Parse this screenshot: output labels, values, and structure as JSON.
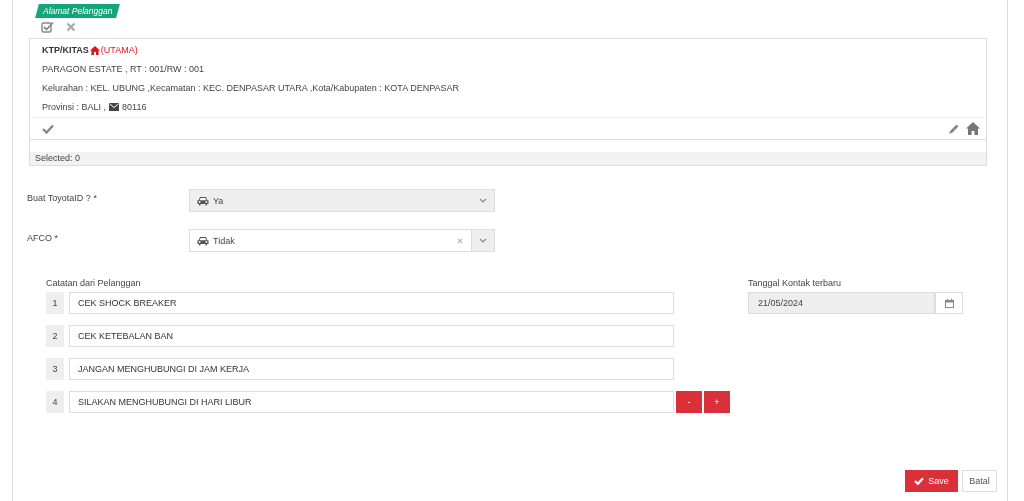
{
  "address_section": {
    "tag": "Alamat Pelanggan",
    "card": {
      "type": "KTP/KITAS",
      "primary_label": "(UTAMA)",
      "line_1": "PARAGON ESTATE , RT : 001/RW : 001",
      "line_2": "Kelurahan : KEL. UBUNG ,Kecamatan : KEC. DENPASAR UTARA ,Kota/Kabupaten : KOTA DENPASAR",
      "province": "Provinsi : BALI ,",
      "postal_code": "80116"
    },
    "selected_count": "Selected: 0"
  },
  "selects": [
    {
      "label": "Buat ToyotaID ? *",
      "value": "Ya",
      "disabled": true
    },
    {
      "label": "AFCO *",
      "value": "Tidak",
      "disabled": false
    }
  ],
  "notes": {
    "label": "Catatan dari Pelanggan",
    "items": [
      {
        "number": "1",
        "text": "CEK SHOCK BREAKER"
      },
      {
        "number": "2",
        "text": "CEK KETEBALAN BAN"
      },
      {
        "number": "3",
        "text": "JANGAN MENGHUBUNGI DI JAM KERJA"
      },
      {
        "number": "4",
        "text": "SILAKAN MENGHUBUNGI DI HARI LIBUR"
      }
    ],
    "remove_button": "-",
    "add_button": "+"
  },
  "last_contact": {
    "label": "Tanggal Kontak terbaru",
    "value": "21/05/2024"
  },
  "buttons": {
    "save": "Save",
    "cancel": "Batal"
  }
}
